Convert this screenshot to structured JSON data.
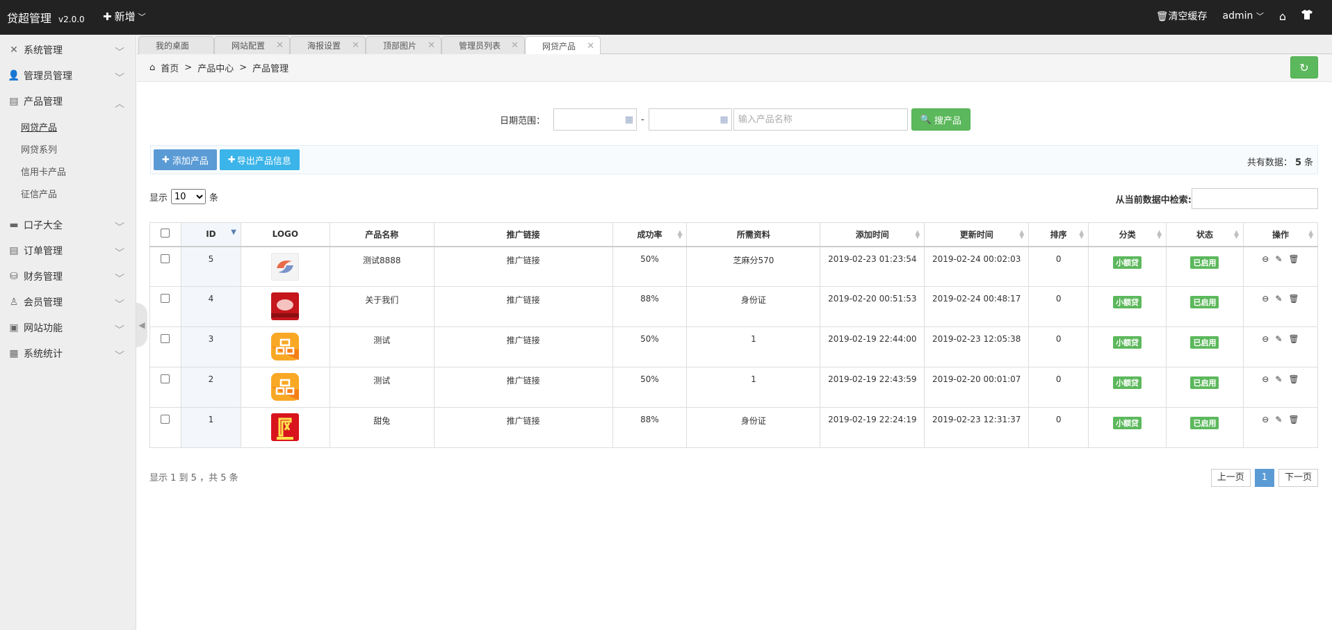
{
  "header": {
    "brand": "贷超管理",
    "version": "v2.0.0",
    "new_label": "新增",
    "clear_cache": "清空缓存",
    "user": "admin"
  },
  "sidebar": {
    "items": [
      {
        "label": "系统管理",
        "icon": "wrench-icon"
      },
      {
        "label": "管理员管理",
        "icon": "user-icon"
      },
      {
        "label": "产品管理",
        "icon": "list-icon",
        "expanded": true,
        "children": [
          "网贷产品",
          "网贷系列",
          "信用卡产品",
          "征信产品"
        ]
      },
      {
        "label": "口子大全",
        "icon": "card-icon"
      },
      {
        "label": "订单管理",
        "icon": "order-icon"
      },
      {
        "label": "财务管理",
        "icon": "finance-icon"
      },
      {
        "label": "会员管理",
        "icon": "member-icon"
      },
      {
        "label": "网站功能",
        "icon": "site-icon"
      },
      {
        "label": "系统统计",
        "icon": "stats-icon"
      }
    ]
  },
  "tabs": [
    {
      "label": "我的桌面"
    },
    {
      "label": "网站配置"
    },
    {
      "label": "海报设置"
    },
    {
      "label": "顶部图片"
    },
    {
      "label": "管理员列表"
    },
    {
      "label": "网贷产品"
    }
  ],
  "breadcrumb": {
    "home": "首页",
    "sep1": ">",
    "level1": "产品中心",
    "sep2": ">",
    "level2": "产品管理"
  },
  "search": {
    "date_label": "日期范围：",
    "date_sep": "-",
    "name_placeholder": "输入产品名称",
    "button": "搜产品"
  },
  "actions": {
    "add": "添加产品",
    "export": "导出产品信息",
    "total_prefix": "共有数据：",
    "total_count": "5",
    "total_suffix": "条"
  },
  "length": {
    "prefix": "显示",
    "value": "10",
    "suffix": "条"
  },
  "filter": {
    "label": "从当前数据中检索:"
  },
  "table": {
    "headers": [
      "",
      "ID",
      "LOGO",
      "产品名称",
      "推广链接",
      "成功率",
      "所需资料",
      "添加时间",
      "更新时间",
      "排序",
      "分类",
      "状态",
      "操作"
    ],
    "rows": [
      {
        "id": "5",
        "logo": "swirl",
        "name": "测试8888",
        "link": "推广链接",
        "rate": "50%",
        "docs": "芝麻分570",
        "added": "2019-02-23 01:23:54",
        "updated": "2019-02-24 00:02:03",
        "order": "0",
        "category": "小额贷",
        "status": "已启用"
      },
      {
        "id": "4",
        "logo": "red-banner",
        "name": "关于我们",
        "link": "推广链接",
        "rate": "88%",
        "docs": "身份证",
        "added": "2019-02-20 00:51:53",
        "updated": "2019-02-24 00:48:17",
        "order": "0",
        "category": "小额贷",
        "status": "已启用"
      },
      {
        "id": "3",
        "logo": "orange-pin",
        "name": "测试",
        "link": "推广链接",
        "rate": "50%",
        "docs": "1",
        "added": "2019-02-19 22:44:00",
        "updated": "2019-02-23 12:05:38",
        "order": "0",
        "category": "小额贷",
        "status": "已启用"
      },
      {
        "id": "2",
        "logo": "orange-pin",
        "name": "测试",
        "link": "推广链接",
        "rate": "50%",
        "docs": "1",
        "added": "2019-02-19 22:43:59",
        "updated": "2019-02-20 00:01:07",
        "order": "0",
        "category": "小额贷",
        "status": "已启用"
      },
      {
        "id": "1",
        "logo": "red-sweet",
        "name": "甜兔",
        "link": "推广链接",
        "rate": "88%",
        "docs": "身份证",
        "added": "2019-02-19 22:24:19",
        "updated": "2019-02-23 12:31:37",
        "order": "0",
        "category": "小额贷",
        "status": "已启用"
      }
    ]
  },
  "footer": {
    "info": "显示 1 到 5 ，共 5 条",
    "prev": "上一页",
    "page": "1",
    "next": "下一页"
  },
  "colors": {
    "green": "#5cb85c",
    "blue": "#5b9bd5",
    "topbar": "#222222"
  }
}
